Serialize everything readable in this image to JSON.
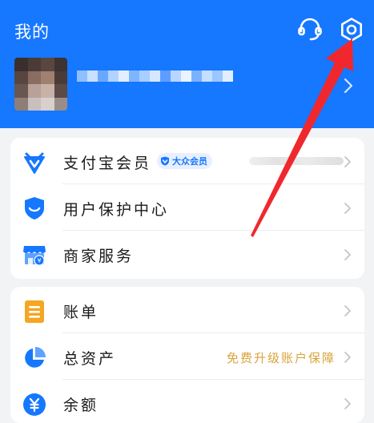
{
  "header": {
    "title": "我的",
    "background": "#1677ff",
    "icons": [
      "customer-service-icon",
      "settings-icon"
    ]
  },
  "profile": {
    "avatar_blurred": true,
    "nickname_blurred": true,
    "chevron": "chevron-right-icon"
  },
  "menu_group_1": {
    "items": [
      {
        "label": "支付宝会员",
        "icon": "alipay-member-icon",
        "badge": "大众会员",
        "badge_color": "#1677ff"
      },
      {
        "label": "用户保护中心",
        "icon": "shield-icon"
      },
      {
        "label": "商家服务",
        "icon": "merchant-store-icon"
      }
    ]
  },
  "menu_group_2": {
    "items": [
      {
        "label": "账单",
        "icon": "bill-icon",
        "icon_color": "#f5a623"
      },
      {
        "label": "总资产",
        "icon": "pie-chart-icon",
        "icon_color": "#1677ff",
        "promo": "免费升级账户保障",
        "promo_color": "#d9a33a"
      },
      {
        "label": "余额",
        "icon": "balance-icon",
        "icon_color": "#1677ff"
      }
    ]
  },
  "annotation": {
    "arrow_color": "#f0282d",
    "points_to": "settings-icon"
  }
}
